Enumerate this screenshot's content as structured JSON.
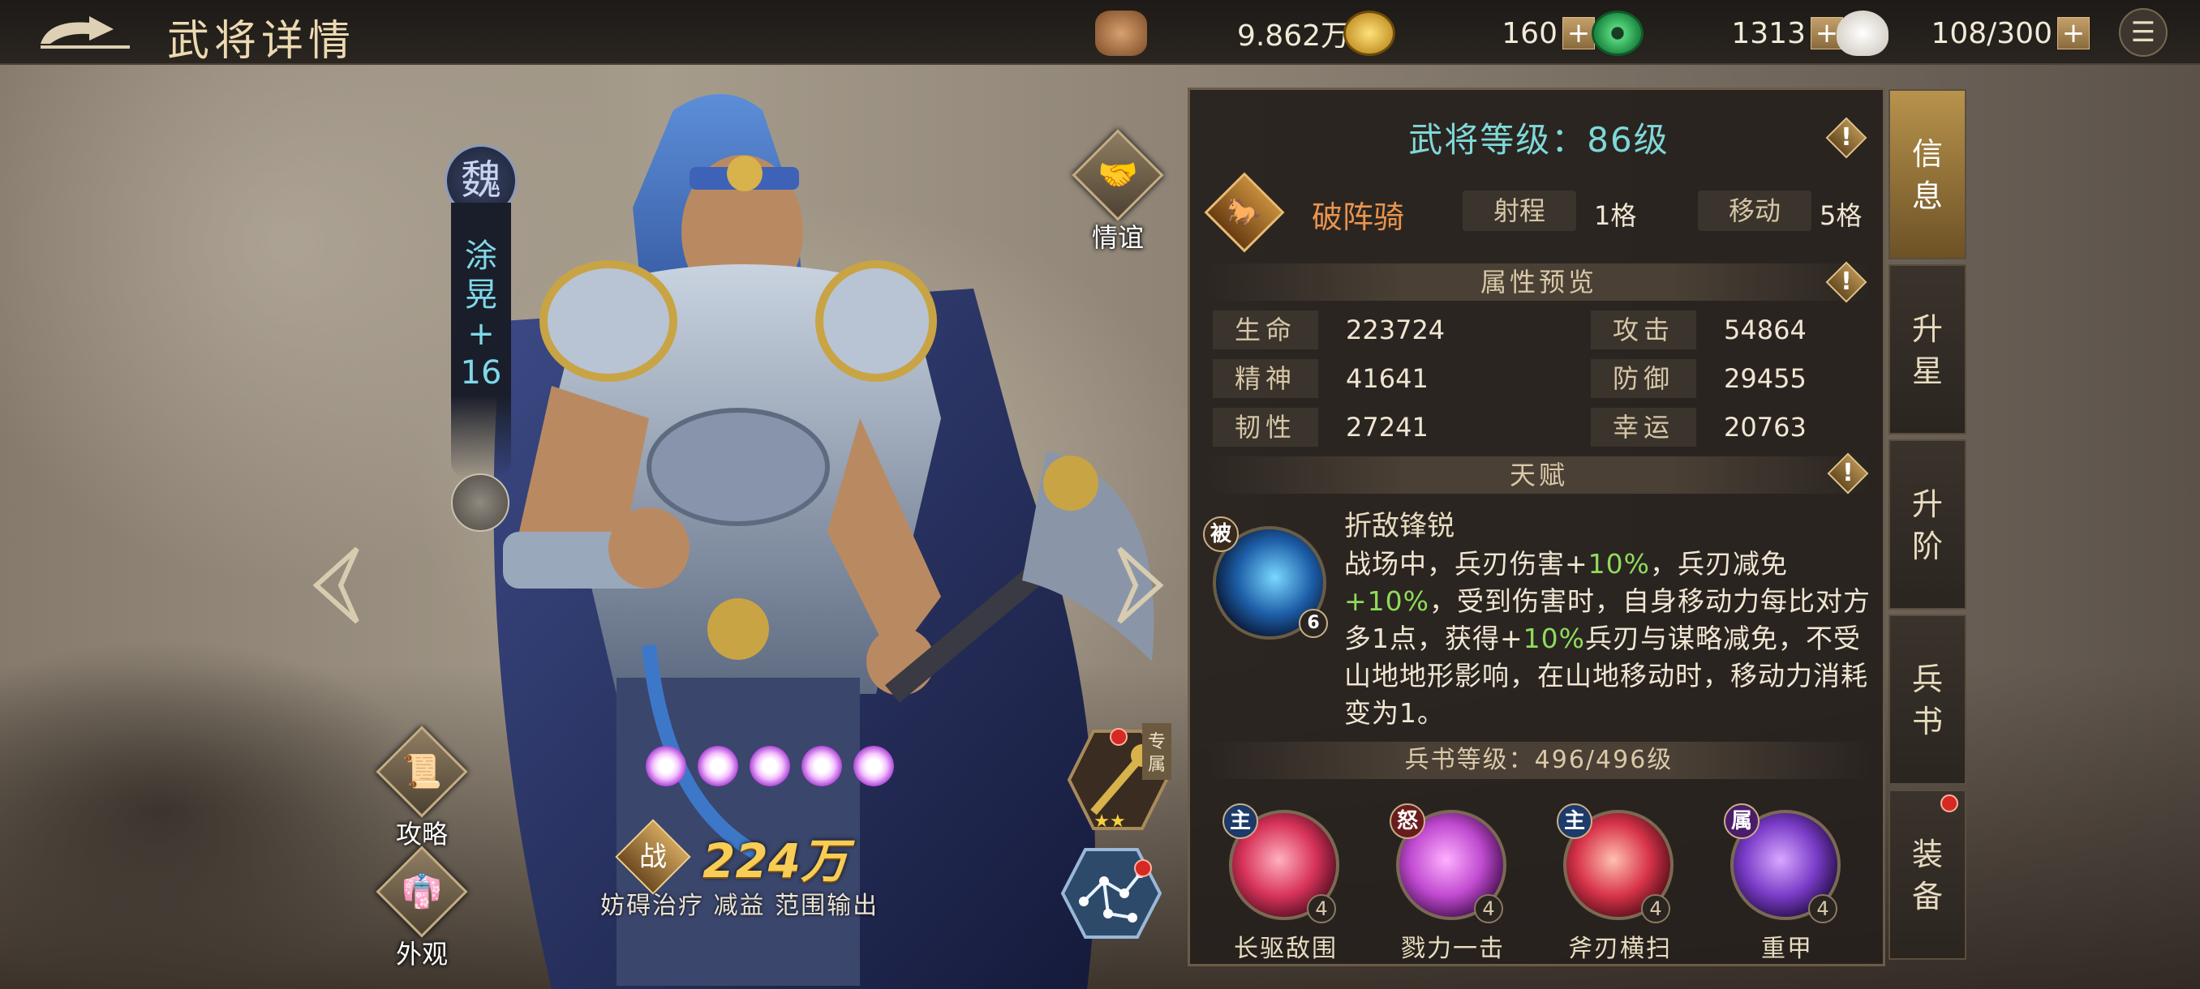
{
  "header": {
    "title": "武将详情"
  },
  "resources": [
    {
      "name": "copper",
      "value": "9.862万",
      "color": "#b07a4a"
    },
    {
      "name": "gold-coin",
      "value": "160",
      "color": "#e0b432"
    },
    {
      "name": "jade",
      "value": "1313",
      "color": "#3db56a"
    },
    {
      "name": "stamina",
      "value": "108/300",
      "color": "#e8e4dc"
    }
  ],
  "hero": {
    "faction": "魏",
    "name_line1": "涂",
    "name_line2": "晃",
    "name_line3": "+",
    "name_line4": "16",
    "power_label": "战",
    "power": "224万",
    "tags": "妨碍治疗 减益 范围输出",
    "exclusive_label": "专属",
    "star_count": 5
  },
  "left_buttons": {
    "friendship": "情谊",
    "strategy": "攻略",
    "appearance": "外观"
  },
  "panel": {
    "level": "武将等级：86级",
    "unit_type": "破阵骑",
    "range_label": "射程",
    "range_value": "1格",
    "move_label": "移动",
    "move_value": "5格",
    "attr_header": "属性预览",
    "attributes": [
      {
        "key": "生命",
        "value": "223724"
      },
      {
        "key": "攻击",
        "value": "54864"
      },
      {
        "key": "精神",
        "value": "41641"
      },
      {
        "key": "防御",
        "value": "29455"
      },
      {
        "key": "韧性",
        "value": "27241"
      },
      {
        "key": "幸运",
        "value": "20763"
      }
    ],
    "talent_header": "天赋",
    "talent_badge": "被",
    "talent_level": "6",
    "talent_name": "折敌锋锐",
    "talent_desc_1": "战场中，兵刃伤害+",
    "talent_desc_p1": "10%",
    "talent_desc_2": "，兵刃减免",
    "talent_desc_p2": "+10%",
    "talent_desc_3": "，受到伤害时，自身移动力每比对方多1点，获得+",
    "talent_desc_p3": "10%",
    "talent_desc_4": "兵刃与谋略减免，不受山地地形影响，在山地移动时，移动力消耗变为1。",
    "book_header": "兵书等级：496/496级",
    "skills": [
      {
        "badge": "主",
        "level": "4",
        "name": "长驱敌围",
        "color": "#d8345a"
      },
      {
        "badge": "怒",
        "level": "4",
        "name": "戮力一击",
        "color": "#c04ad0"
      },
      {
        "badge": "主",
        "level": "4",
        "name": "斧刃横扫",
        "color": "#d8344a"
      },
      {
        "badge": "属",
        "level": "4",
        "name": "重甲",
        "color": "#7a3cc8"
      }
    ]
  },
  "tabs": [
    {
      "l1": "信",
      "l2": "息"
    },
    {
      "l1": "升",
      "l2": "星"
    },
    {
      "l1": "升",
      "l2": "阶"
    },
    {
      "l1": "兵",
      "l2": "书"
    },
    {
      "l1": "装",
      "l2": "备"
    }
  ]
}
